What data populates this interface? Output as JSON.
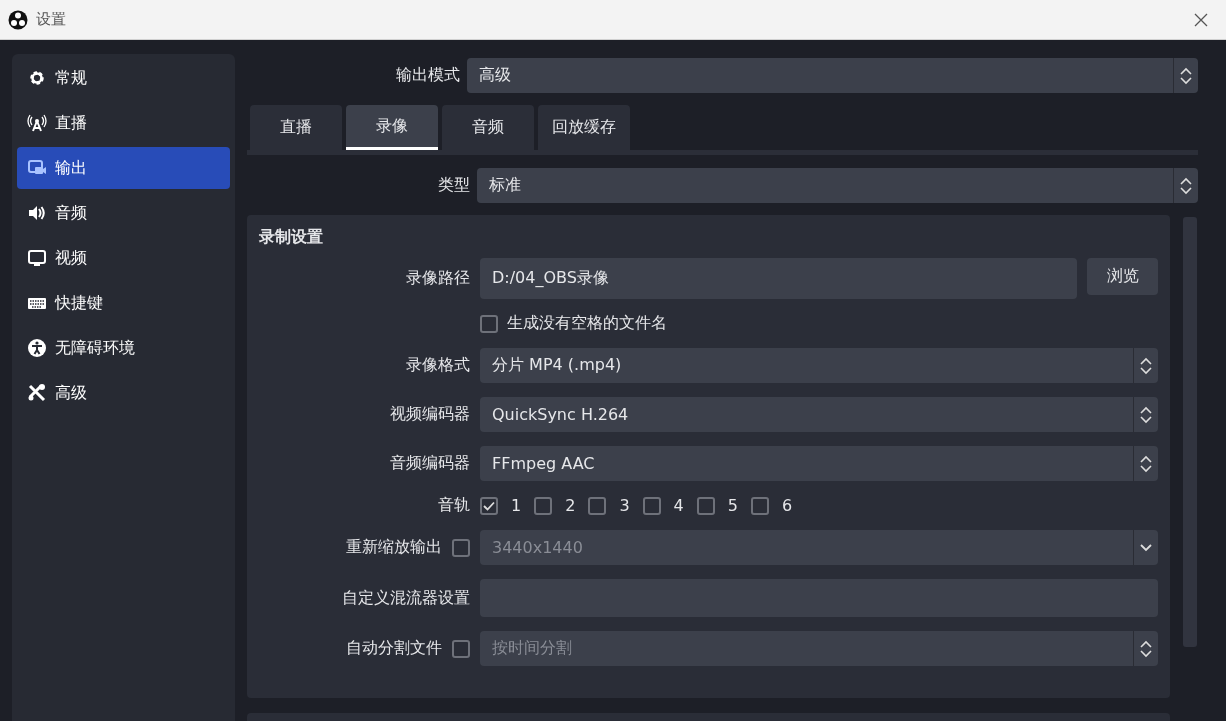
{
  "window": {
    "title": "设置"
  },
  "sidebar": {
    "items": [
      {
        "label": "常规",
        "selected": false
      },
      {
        "label": "直播",
        "selected": false
      },
      {
        "label": "输出",
        "selected": true
      },
      {
        "label": "音频",
        "selected": false
      },
      {
        "label": "视频",
        "selected": false
      },
      {
        "label": "快捷键",
        "selected": false
      },
      {
        "label": "无障碍环境",
        "selected": false
      },
      {
        "label": "高级",
        "selected": false
      }
    ]
  },
  "output_mode": {
    "label": "输出模式",
    "value": "高级"
  },
  "tabs": [
    {
      "label": "直播",
      "selected": false
    },
    {
      "label": "录像",
      "selected": true
    },
    {
      "label": "音频",
      "selected": false
    },
    {
      "label": "回放缓存",
      "selected": false
    }
  ],
  "type": {
    "label": "类型",
    "value": "标准"
  },
  "recording_settings": {
    "title": "录制设置",
    "rows": [
      {
        "kind": "path",
        "label": "录像路径",
        "value": "D:/04_OBS录像",
        "button": "浏览"
      },
      {
        "kind": "checkbox",
        "label": "生成没有空格的文件名",
        "checked": false
      },
      {
        "kind": "select",
        "label": "录像格式",
        "value": "分片 MP4 (.mp4)"
      },
      {
        "kind": "select",
        "label": "视频编码器",
        "value": "QuickSync H.264"
      },
      {
        "kind": "select",
        "label": "音频编码器",
        "value": "FFmpeg AAC"
      },
      {
        "kind": "tracks",
        "label": "音轨",
        "tracks": [
          {
            "label": "1",
            "checked": true
          },
          {
            "label": "2",
            "checked": false
          },
          {
            "label": "3",
            "checked": false
          },
          {
            "label": "4",
            "checked": false
          },
          {
            "label": "5",
            "checked": false
          },
          {
            "label": "6",
            "checked": false
          }
        ]
      },
      {
        "kind": "check_editable",
        "label": "重新缩放输出",
        "checked": false,
        "value": "3440x1440",
        "disabled": true
      },
      {
        "kind": "text",
        "label": "自定义混流器设置"
      },
      {
        "kind": "check_select",
        "label": "自动分割文件",
        "checked": false,
        "value": "按时间分割",
        "disabled": true
      }
    ]
  }
}
